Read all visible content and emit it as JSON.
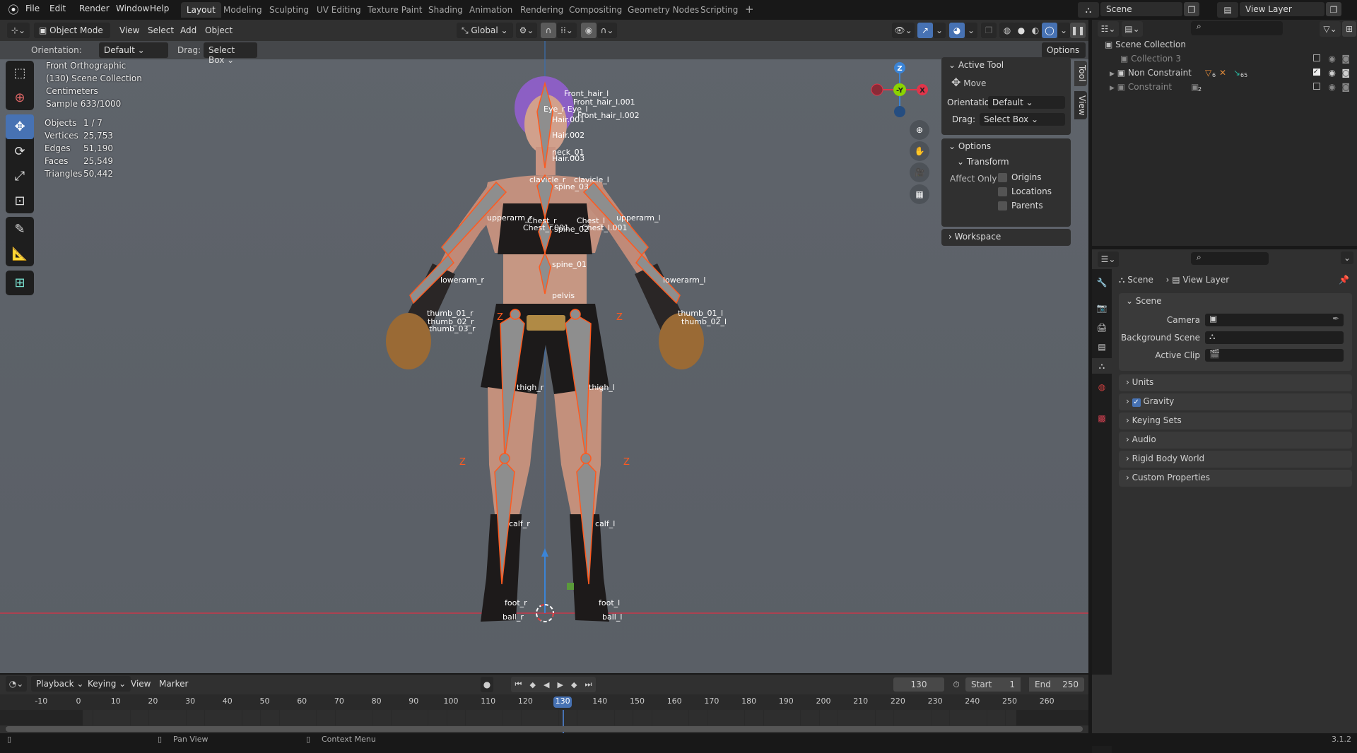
{
  "topbar": {
    "menus": [
      "File",
      "Edit",
      "Render",
      "Window",
      "Help"
    ],
    "workspaces": [
      "Layout",
      "Modeling",
      "Sculpting",
      "UV Editing",
      "Texture Paint",
      "Shading",
      "Animation",
      "Rendering",
      "Compositing",
      "Geometry Nodes",
      "Scripting"
    ],
    "active_workspace": "Layout",
    "add_workspace": "+",
    "scene": "Scene",
    "view_layer": "View Layer"
  },
  "header": {
    "mode": "Object Mode",
    "menus": [
      "View",
      "Select",
      "Add",
      "Object"
    ],
    "orientation": "Global",
    "options": "Options"
  },
  "tool_settings": {
    "orientation_label": "Orientation:",
    "orientation_value": "Default",
    "drag_label": "Drag:",
    "drag_value": "Select Box"
  },
  "overlay": {
    "view": "Front Orthographic",
    "collection": "(130) Scene Collection",
    "units": "Centimeters",
    "sample": "Sample 633/1000",
    "stats": [
      {
        "label": "Objects",
        "value": "1 / 7"
      },
      {
        "label": "Vertices",
        "value": "25,753"
      },
      {
        "label": "Edges",
        "value": "51,190"
      },
      {
        "label": "Faces",
        "value": "25,549"
      },
      {
        "label": "Triangles",
        "value": "50,442"
      }
    ]
  },
  "gizmo": {
    "z": "Z",
    "y": "-Y",
    "x": "X"
  },
  "viewport": {
    "bones": [
      "Front_hair_l",
      "Front_hair_l.001",
      "Front_hair_l.002",
      "Eye_r  Eye_l",
      "Hair.001",
      "Hair.002",
      "neck_01",
      "Hair.003",
      "clavicle_r",
      "clavicle_l",
      "spine_03",
      "upperarm_r",
      "upperarm_l",
      "Chest_r",
      "Chest_l",
      "Chest_r.001",
      "Chest_l.001",
      "spine_02",
      "spine_01",
      "lowerarm_r",
      "lowerarm_l",
      "pelvis",
      "thumb_01_r",
      "thumb_02_r",
      "thumb_03_r",
      "thumb_01_l",
      "thumb_02_l",
      "thigh_r",
      "thigh_l",
      "calf_r",
      "calf_l",
      "foot_r",
      "foot_l",
      "ball_r",
      "ball_l"
    ],
    "axis_z": "Z"
  },
  "npanel": {
    "tabs": [
      "Tool",
      "View"
    ],
    "active_tool_title": "Active Tool",
    "tool_name": "Move",
    "orientation_label": "Orientation",
    "orientation_value": "Default",
    "drag_label": "Drag:",
    "drag_value": "Select Box",
    "options_title": "Options",
    "transform_title": "Transform",
    "affect_only": "Affect Only",
    "affect_items": [
      "Origins",
      "Locations",
      "Parents"
    ],
    "workspace_title": "Workspace"
  },
  "outliner": {
    "root": "Scene Collection",
    "items": [
      {
        "name": "Collection 3",
        "checked": false
      },
      {
        "name": "Non Constraint",
        "checked": true,
        "badges": [
          "6",
          "65"
        ]
      },
      {
        "name": "Constraint",
        "checked": false,
        "badges": [
          "2"
        ]
      }
    ]
  },
  "properties": {
    "breadcrumb": [
      "Scene",
      "View Layer"
    ],
    "scene_panel": "Scene",
    "fields": [
      "Camera",
      "Background Scene",
      "Active Clip"
    ],
    "sections": [
      "Units",
      "Gravity",
      "Keying Sets",
      "Audio",
      "Rigid Body World",
      "Custom Properties"
    ],
    "gravity_enabled": true
  },
  "timeline": {
    "menus": [
      "Playback",
      "Keying",
      "View",
      "Marker"
    ],
    "current_frame": "130",
    "start_label": "Start",
    "start": "1",
    "end_label": "End",
    "end": "250",
    "ticks": [
      "-10",
      "0",
      "10",
      "20",
      "30",
      "40",
      "50",
      "60",
      "70",
      "80",
      "90",
      "100",
      "110",
      "120",
      "130",
      "140",
      "150",
      "160",
      "170",
      "180",
      "190",
      "200",
      "210",
      "220",
      "230",
      "240",
      "250",
      "260"
    ]
  },
  "status": {
    "pan": "Pan View",
    "context": "Context Menu",
    "version": "3.1.2"
  },
  "colors": {
    "accent": "#4772b3",
    "bone_outline": "#ff5a1f",
    "x_axis": "#e0354a",
    "y_axis": "#8bd400",
    "z_axis": "#3b84d6"
  }
}
